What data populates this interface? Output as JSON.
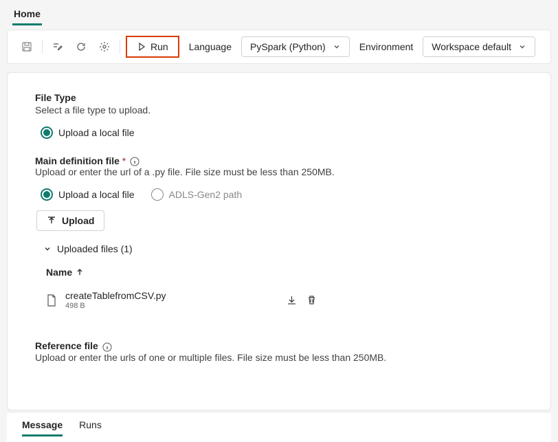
{
  "header": {
    "tab": "Home"
  },
  "toolbar": {
    "run_label": "Run",
    "language_label": "Language",
    "language_value": "PySpark (Python)",
    "env_label": "Environment",
    "env_value": "Workspace default"
  },
  "file_type": {
    "title": "File Type",
    "subtitle": "Select a file type to upload.",
    "option_local": "Upload a local file"
  },
  "main_def": {
    "title": "Main definition file",
    "subtitle": "Upload or enter the url of a .py file. File size must be less than 250MB.",
    "option_local": "Upload a local file",
    "option_adls": "ADLS-Gen2 path",
    "upload_btn": "Upload",
    "uploaded_header": "Uploaded files (1)",
    "col_name": "Name",
    "file": {
      "name": "createTablefromCSV.py",
      "size": "498 B"
    }
  },
  "reference": {
    "title": "Reference file",
    "subtitle": "Upload or enter the urls of one or multiple files. File size must be less than 250MB."
  },
  "bottom": {
    "message": "Message",
    "runs": "Runs"
  }
}
